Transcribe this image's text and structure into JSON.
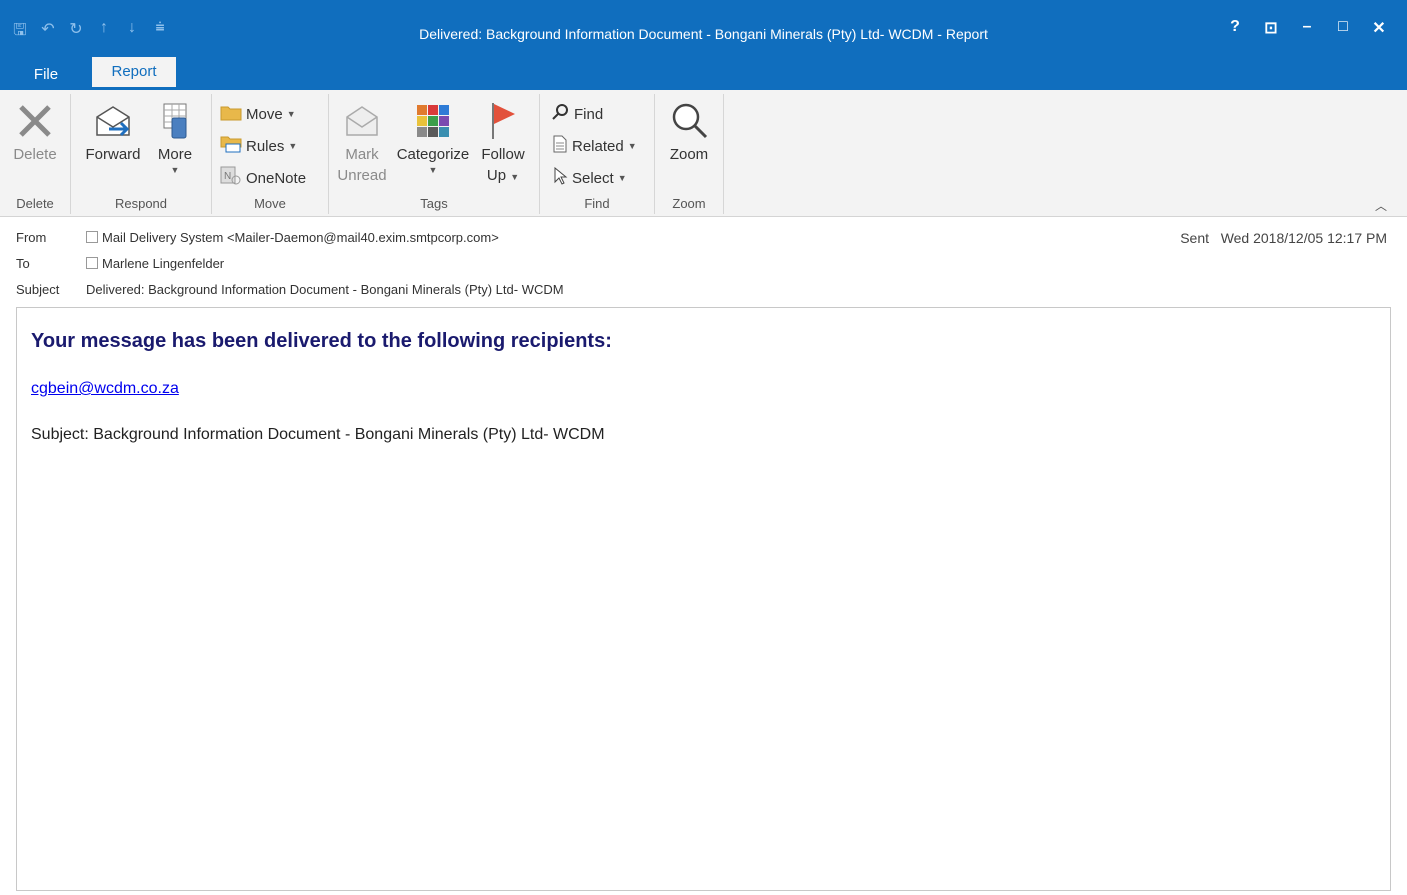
{
  "window": {
    "title": "Delivered: Background Information Document - Bongani Minerals (Pty) Ltd- WCDM - Report",
    "qat": [
      "save-icon",
      "undo-icon",
      "redo-icon",
      "up-icon",
      "down-icon",
      "customize-icon"
    ],
    "controls": {
      "help": "?",
      "ribbon_display": "⊡",
      "minimize": "–",
      "maximize": "□",
      "close": "✕"
    }
  },
  "tabs": {
    "file": "File",
    "report": "Report"
  },
  "ribbon": {
    "delete_group": {
      "label": "Delete",
      "delete": "Delete"
    },
    "respond_group": {
      "label": "Respond",
      "forward": "Forward",
      "more": "More"
    },
    "move_group": {
      "label": "Move",
      "move": "Move",
      "rules": "Rules",
      "onenote": "OneNote"
    },
    "tags_group": {
      "label": "Tags",
      "mark_unread_1": "Mark",
      "mark_unread_2": "Unread",
      "categorize": "Categorize",
      "follow_up_1": "Follow",
      "follow_up_2": "Up"
    },
    "find_group": {
      "label": "Find",
      "find": "Find",
      "related": "Related",
      "select": "Select"
    },
    "zoom_group": {
      "label": "Zoom",
      "zoom": "Zoom"
    }
  },
  "header": {
    "from_label": "From",
    "from_value": "Mail Delivery System <Mailer-Daemon@mail40.exim.smtpcorp.com>",
    "to_label": "To",
    "to_value": "Marlene Lingenfelder",
    "subject_label": "Subject",
    "subject_value": "Delivered: Background Information Document - Bongani Minerals (Pty) Ltd- WCDM",
    "sent_label": "Sent",
    "sent_value": "Wed 2018/12/05 12:17 PM"
  },
  "message": {
    "heading": "Your message has been delivered to the following recipients:",
    "recipient": "cgbein@wcdm.co.za",
    "subject_line": "Subject: Background Information Document - Bongani Minerals (Pty) Ltd- WCDM"
  }
}
